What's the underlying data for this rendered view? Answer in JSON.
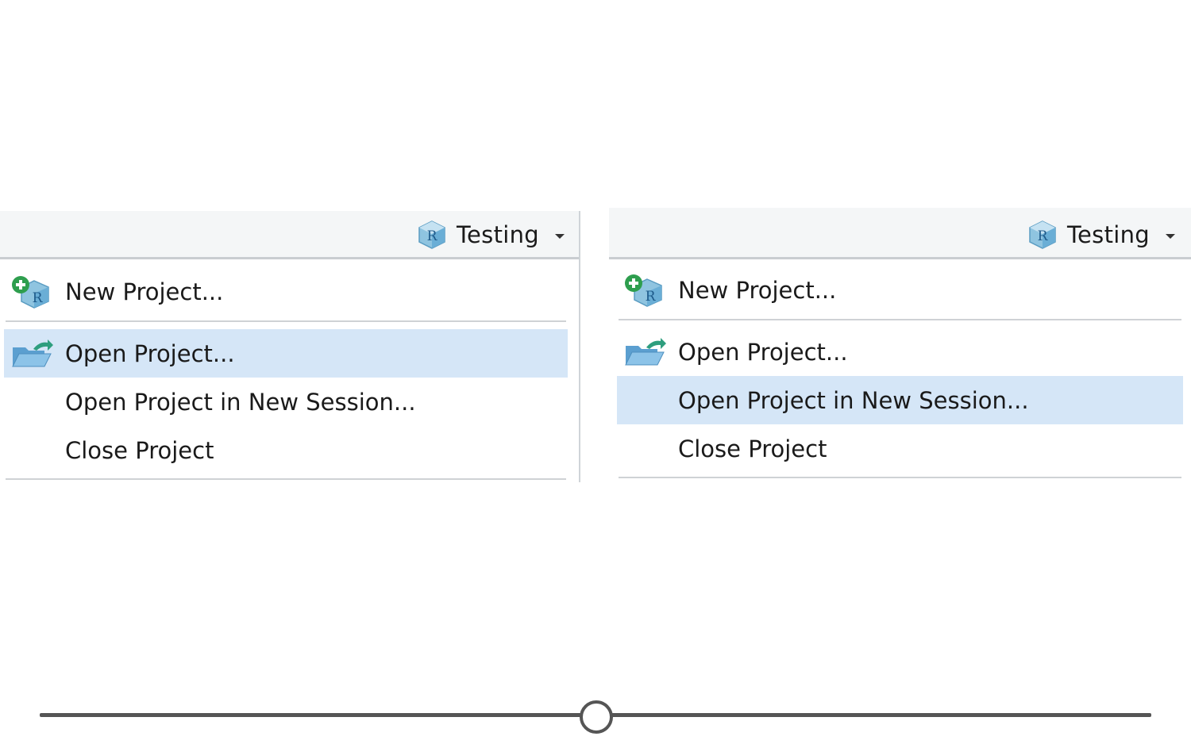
{
  "panels": [
    {
      "project_name": "Testing",
      "items": [
        {
          "label": "New Project...",
          "icon": "new-project-icon"
        },
        {
          "label": "Open Project...",
          "icon": "open-project-icon"
        },
        {
          "label": "Open Project in New Session..."
        },
        {
          "label": "Close Project"
        }
      ],
      "highlighted_item": "Open Project..."
    },
    {
      "project_name": "Testing",
      "items": [
        {
          "label": "New Project...",
          "icon": "new-project-icon"
        },
        {
          "label": "Open Project...",
          "icon": "open-project-icon"
        },
        {
          "label": "Open Project in New Session..."
        },
        {
          "label": "Close Project"
        }
      ],
      "highlighted_item": "Open Project in New Session..."
    }
  ],
  "slider": {
    "value": 0.5
  },
  "colors": {
    "highlight": "#d5e6f7",
    "toolbar_bg": "#f4f6f7",
    "slider": "#555555"
  }
}
